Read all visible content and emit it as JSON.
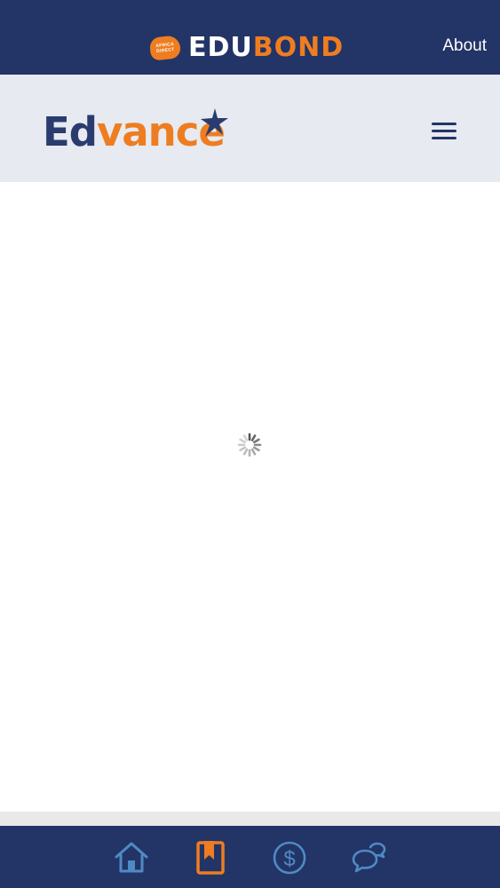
{
  "header": {
    "brand_badge_line1": "AFRICA",
    "brand_badge_line2": "DIRECT",
    "brand_part1": "EDU",
    "brand_part2": "BOND",
    "about_label": "About"
  },
  "subheader": {
    "logo_part1": "Ed",
    "logo_part2": "vance"
  },
  "tabs": [
    {
      "icon": "home-icon",
      "active": false
    },
    {
      "icon": "bookmark-icon",
      "active": true
    },
    {
      "icon": "dollar-icon",
      "active": false
    },
    {
      "icon": "chat-icon",
      "active": false
    }
  ],
  "colors": {
    "navy": "#233466",
    "orange": "#ee7d21",
    "light_gray": "#e7eaf0",
    "tab_inactive": "#4f8ac4"
  }
}
